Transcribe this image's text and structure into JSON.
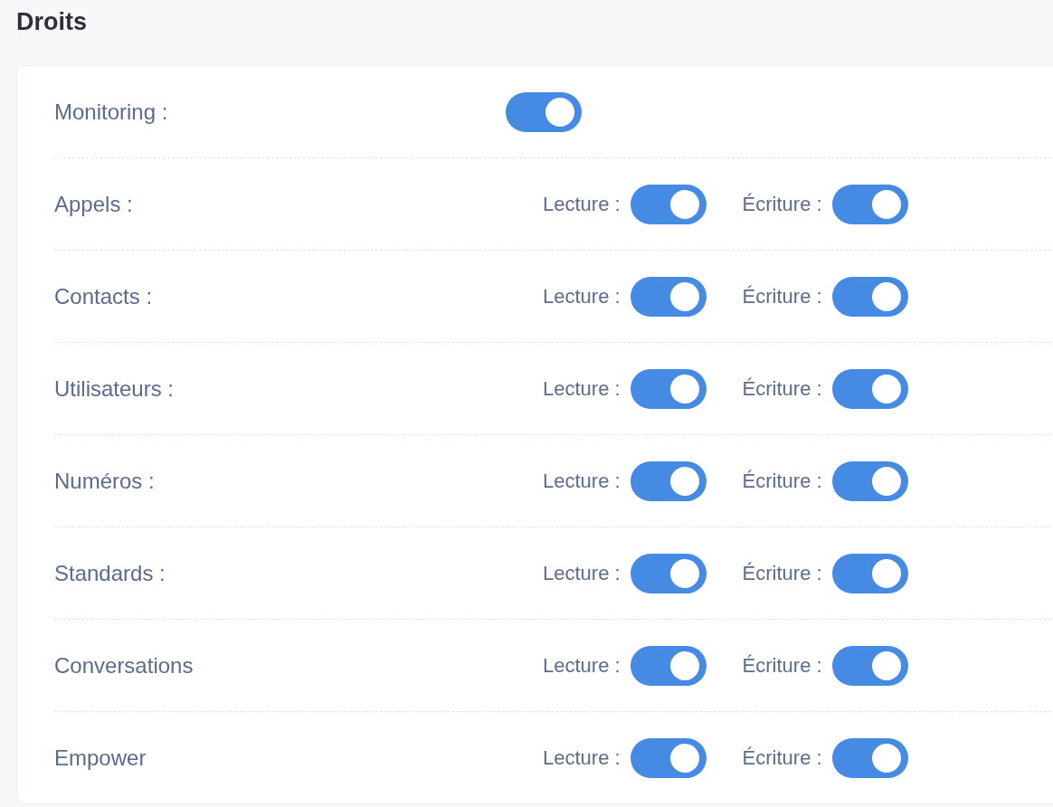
{
  "title": "Droits",
  "rows": [
    {
      "kind": "single",
      "label": "Monitoring :",
      "toggle": {
        "on": true
      }
    },
    {
      "kind": "pair",
      "label": "Appels :",
      "read": {
        "label": "Lecture :",
        "on": true
      },
      "write": {
        "label": "Écriture :",
        "on": true
      }
    },
    {
      "kind": "pair",
      "label": "Contacts :",
      "read": {
        "label": "Lecture :",
        "on": true
      },
      "write": {
        "label": "Écriture :",
        "on": true
      }
    },
    {
      "kind": "pair",
      "label": "Utilisateurs :",
      "read": {
        "label": "Lecture :",
        "on": true
      },
      "write": {
        "label": "Écriture :",
        "on": true
      }
    },
    {
      "kind": "pair",
      "label": "Numéros :",
      "read": {
        "label": "Lecture :",
        "on": true
      },
      "write": {
        "label": "Écriture :",
        "on": true
      }
    },
    {
      "kind": "pair",
      "label": "Standards :",
      "read": {
        "label": "Lecture :",
        "on": true
      },
      "write": {
        "label": "Écriture :",
        "on": true
      }
    },
    {
      "kind": "pair",
      "label": "Conversations",
      "read": {
        "label": "Lecture :",
        "on": true
      },
      "write": {
        "label": "Écriture :",
        "on": true
      }
    },
    {
      "kind": "pair",
      "label": "Empower",
      "read": {
        "label": "Lecture :",
        "on": true
      },
      "write": {
        "label": "Écriture :",
        "on": true
      }
    }
  ]
}
